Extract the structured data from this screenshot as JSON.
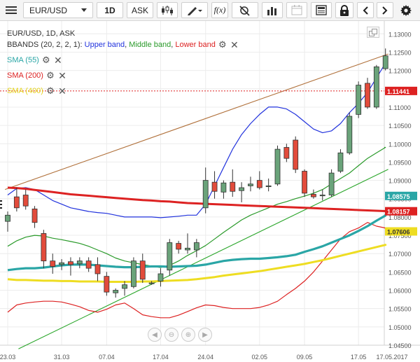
{
  "toolbar": {
    "menu_icon": "hamburger-icon",
    "symbol": "EUR/USD",
    "interval": "1D",
    "price_type": "ASK",
    "icons": [
      "candles-icon",
      "pencil-icon",
      "fx-icon",
      "crosshair-off-icon",
      "bars-icon",
      "calendar-icon",
      "news-icon",
      "lock-icon",
      "chevron-left-icon",
      "chevron-right-icon",
      "gear-icon"
    ]
  },
  "legend": {
    "title": "EUR/USD, 1D, ASK",
    "bbands_prefix": "BBANDS (20, 2, 2, 1): ",
    "bb_upper": "Upper band",
    "bb_middle": "Middle band",
    "bb_lower": "Lower band",
    "sep": ", ",
    "sma55": "SMA (55)",
    "sma200": "SMA (200)",
    "sma400": "SMA (400)"
  },
  "colors": {
    "up_candle": "#6aa37a",
    "down_candle": "#e24b3b",
    "bb_upper": "#2233dd",
    "bb_middle": "#2a9a2a",
    "bb_lower": "#dd2222",
    "sma55": "#2aa6a6",
    "sma200": "#dd2222",
    "sma400": "#eedd22",
    "trend_upper": "#b0703a",
    "trend_lower": "#2aa62a"
  },
  "chart_data": {
    "type": "candlestick",
    "ylim": [
      1.045,
      1.1335
    ],
    "y_ticks": [
      1.13,
      1.125,
      1.12,
      1.115,
      1.11,
      1.105,
      1.1,
      1.095,
      1.09,
      1.085,
      1.08,
      1.075,
      1.07,
      1.065,
      1.06,
      1.055,
      1.05
    ],
    "y_tick_labels": [
      "1.13000",
      "1.12500",
      "1.12000",
      "1.11500",
      "1.11000",
      "1.10500",
      "1.10000",
      "1.09500",
      "1.09000",
      "1.08500",
      "1.08000",
      "1.07500",
      "1.07000",
      "1.06500",
      "1.06000",
      "1.05500",
      "1.05000",
      "1.04500"
    ],
    "x_labels": [
      "23.03",
      "31.03",
      "07.04",
      "17.04",
      "24.04",
      "02.05",
      "09.05",
      "17.05",
      "17.05.2017"
    ],
    "x_label_index": [
      0,
      6,
      11,
      17,
      22,
      28,
      33,
      39,
      42
    ],
    "candles": [
      {
        "o": 1.0788,
        "h": 1.0815,
        "l": 1.076,
        "c": 1.0805
      },
      {
        "o": 1.0855,
        "h": 1.088,
        "l": 1.0815,
        "c": 1.0825
      },
      {
        "o": 1.086,
        "h": 1.0875,
        "l": 1.082,
        "c": 1.083
      },
      {
        "o": 1.0822,
        "h": 1.083,
        "l": 1.077,
        "c": 1.0785
      },
      {
        "o": 1.0755,
        "h": 1.0765,
        "l": 1.066,
        "c": 1.068
      },
      {
        "o": 1.068,
        "h": 1.07,
        "l": 1.0645,
        "c": 1.0665
      },
      {
        "o": 1.067,
        "h": 1.0685,
        "l": 1.0655,
        "c": 1.0675
      },
      {
        "o": 1.0678,
        "h": 1.069,
        "l": 1.064,
        "c": 1.067
      },
      {
        "o": 1.0672,
        "h": 1.069,
        "l": 1.066,
        "c": 1.068
      },
      {
        "o": 1.068,
        "h": 1.069,
        "l": 1.065,
        "c": 1.066
      },
      {
        "o": 1.067,
        "h": 1.069,
        "l": 1.0625,
        "c": 1.0645
      },
      {
        "o": 1.0638,
        "h": 1.065,
        "l": 1.0585,
        "c": 1.0595
      },
      {
        "o": 1.0593,
        "h": 1.0605,
        "l": 1.058,
        "c": 1.06
      },
      {
        "o": 1.0605,
        "h": 1.0625,
        "l": 1.0585,
        "c": 1.0615
      },
      {
        "o": 1.061,
        "h": 1.069,
        "l": 1.0605,
        "c": 1.068
      },
      {
        "o": 1.068,
        "h": 1.07,
        "l": 1.062,
        "c": 1.063
      },
      {
        "o": 1.062,
        "h": 1.0625,
        "l": 1.0615,
        "c": 1.062
      },
      {
        "o": 1.0625,
        "h": 1.066,
        "l": 1.061,
        "c": 1.0645
      },
      {
        "o": 1.0655,
        "h": 1.074,
        "l": 1.064,
        "c": 1.073
      },
      {
        "o": 1.0728,
        "h": 1.0735,
        "l": 1.07,
        "c": 1.0712
      },
      {
        "o": 1.071,
        "h": 1.0755,
        "l": 1.07,
        "c": 1.0715
      },
      {
        "o": 1.071,
        "h": 1.074,
        "l": 1.069,
        "c": 1.073
      },
      {
        "o": 1.0825,
        "h": 1.0935,
        "l": 1.081,
        "c": 1.09
      },
      {
        "o": 1.0895,
        "h": 1.0925,
        "l": 1.085,
        "c": 1.087
      },
      {
        "o": 1.0868,
        "h": 1.09,
        "l": 1.085,
        "c": 1.0893
      },
      {
        "o": 1.0895,
        "h": 1.093,
        "l": 1.0855,
        "c": 1.087
      },
      {
        "o": 1.0872,
        "h": 1.0895,
        "l": 1.084,
        "c": 1.088
      },
      {
        "o": 1.0885,
        "h": 1.091,
        "l": 1.087,
        "c": 1.089
      },
      {
        "o": 1.09,
        "h": 1.0925,
        "l": 1.0875,
        "c": 1.088
      },
      {
        "o": 1.0885,
        "h": 1.0905,
        "l": 1.087,
        "c": 1.0885
      },
      {
        "o": 1.089,
        "h": 1.0995,
        "l": 1.0885,
        "c": 1.0985
      },
      {
        "o": 1.099,
        "h": 1.1,
        "l": 1.095,
        "c": 1.096
      },
      {
        "o": 1.101,
        "h": 1.102,
        "l": 1.092,
        "c": 1.093
      },
      {
        "o": 1.0925,
        "h": 1.093,
        "l": 1.0855,
        "c": 1.0865
      },
      {
        "o": 1.0862,
        "h": 1.0875,
        "l": 1.085,
        "c": 1.0855
      },
      {
        "o": 1.0858,
        "h": 1.0875,
        "l": 1.0845,
        "c": 1.086
      },
      {
        "o": 1.086,
        "h": 1.093,
        "l": 1.0855,
        "c": 1.092
      },
      {
        "o": 1.0925,
        "h": 1.0985,
        "l": 1.092,
        "c": 1.0975
      },
      {
        "o": 1.0975,
        "h": 1.1085,
        "l": 1.097,
        "c": 1.1075
      },
      {
        "o": 1.108,
        "h": 1.117,
        "l": 1.107,
        "c": 1.116
      },
      {
        "o": 1.1165,
        "h": 1.118,
        "l": 1.1095,
        "c": 1.11
      },
      {
        "o": 1.11,
        "h": 1.1215,
        "l": 1.1095,
        "c": 1.121
      },
      {
        "o": 1.1205,
        "h": 1.126,
        "l": 1.12,
        "c": 1.124
      }
    ],
    "bb_upper": [
      1.086,
      1.0878,
      1.088,
      1.0875,
      1.086,
      1.0845,
      1.0835,
      1.0825,
      1.082,
      1.0815,
      1.0812,
      1.081,
      1.0805,
      1.08,
      1.08,
      1.08,
      1.08,
      1.0798,
      1.08,
      1.0802,
      1.0805,
      1.0805,
      1.0835,
      1.0885,
      1.0935,
      1.0985,
      1.1025,
      1.1055,
      1.108,
      1.11,
      1.11,
      1.1095,
      1.108,
      1.106,
      1.104,
      1.103,
      1.1035,
      1.1055,
      1.1085,
      1.111,
      1.114,
      1.118,
      1.122
    ],
    "bb_middle": [
      1.072,
      1.0735,
      1.0745,
      1.075,
      1.0748,
      1.0742,
      1.0738,
      1.0733,
      1.0728,
      1.072,
      1.071,
      1.07,
      1.0688,
      1.068,
      1.0675,
      1.067,
      1.0666,
      1.0662,
      1.0668,
      1.068,
      1.0695,
      1.0708,
      1.0722,
      1.074,
      1.0758,
      1.0775,
      1.0792,
      1.0805,
      1.0815,
      1.0825,
      1.0835,
      1.0842,
      1.085,
      1.0857,
      1.0865,
      1.0875,
      1.089,
      1.0905,
      1.092,
      1.094,
      1.096,
      1.0975,
      1.099
    ],
    "bb_lower": [
      1.054,
      1.056,
      1.0565,
      1.0568,
      1.057,
      1.057,
      1.0568,
      1.0562,
      1.0555,
      1.0545,
      1.054,
      1.0548,
      1.056,
      1.0565,
      1.055,
      1.0533,
      1.0528,
      1.0525,
      1.0525,
      1.0532,
      1.0542,
      1.0552,
      1.056,
      1.0558,
      1.0553,
      1.055,
      1.055,
      1.055,
      1.0553,
      1.056,
      1.057,
      1.0588,
      1.0605,
      1.0625,
      1.065,
      1.068,
      1.071,
      1.074,
      1.076,
      1.077,
      1.0785,
      1.0775,
      1.077
    ],
    "sma55": [
      1.0655,
      1.0658,
      1.066,
      1.066,
      1.0662,
      1.0665,
      1.0668,
      1.067,
      1.067,
      1.067,
      1.0668,
      1.0666,
      1.0664,
      1.0663,
      1.0663,
      1.0664,
      1.0665,
      1.0665,
      1.0664,
      1.0665,
      1.0666,
      1.0667,
      1.067,
      1.0675,
      1.068,
      1.0683,
      1.0685,
      1.0686,
      1.0686,
      1.0688,
      1.069,
      1.0693,
      1.0697,
      1.0705,
      1.0712,
      1.072,
      1.073,
      1.074,
      1.075,
      1.0762,
      1.0775,
      1.079,
      1.0804
    ],
    "sma200": [
      1.088,
      1.0879,
      1.0877,
      1.0874,
      1.0871,
      1.0868,
      1.0865,
      1.0862,
      1.086,
      1.0858,
      1.0856,
      1.0854,
      1.0852,
      1.085,
      1.0848,
      1.0846,
      1.0845,
      1.0843,
      1.0842,
      1.084,
      1.0838,
      1.0837,
      1.0836,
      1.0835,
      1.0834,
      1.0833,
      1.0832,
      1.0831,
      1.083,
      1.0829,
      1.0828,
      1.0827,
      1.0826,
      1.0825,
      1.0824,
      1.0823,
      1.0822,
      1.0821,
      1.082,
      1.0819,
      1.0818,
      1.0817,
      1.0816
    ],
    "sma400": [
      1.063,
      1.0628,
      1.0628,
      1.0627,
      1.0626,
      1.0626,
      1.0625,
      1.0625,
      1.0624,
      1.0624,
      1.0624,
      1.0623,
      1.0623,
      1.0623,
      1.0623,
      1.0624,
      1.0624,
      1.0625,
      1.0626,
      1.0627,
      1.0628,
      1.063,
      1.0633,
      1.0636,
      1.064,
      1.0643,
      1.0646,
      1.0649,
      1.0652,
      1.0656,
      1.066,
      1.0664,
      1.0668,
      1.0672,
      1.0677,
      1.0682,
      1.0688,
      1.0694,
      1.07,
      1.0706,
      1.0712,
      1.0718,
      1.0724
    ],
    "trend_upper": {
      "from": [
        -0.3,
        1.0875
      ],
      "to": [
        42.3,
        1.1245
      ]
    },
    "trend_lower": {
      "from": [
        1.2,
        1.044
      ],
      "to": [
        42.3,
        1.093
      ]
    },
    "current_price": 1.11441,
    "price_badges": [
      {
        "value": "1.11441",
        "price": 1.11441,
        "bg": "#dd2222",
        "fg": "#ffffff"
      },
      {
        "value": "1.08575",
        "price": 1.08575,
        "bg": "#2aa6a6",
        "fg": "#ffffff"
      },
      {
        "value": "1.08157",
        "price": 1.08157,
        "bg": "#dd2222",
        "fg": "#ffffff"
      },
      {
        "value": "1.07606",
        "price": 1.07606,
        "bg": "#eedd22",
        "fg": "#333333"
      }
    ]
  }
}
